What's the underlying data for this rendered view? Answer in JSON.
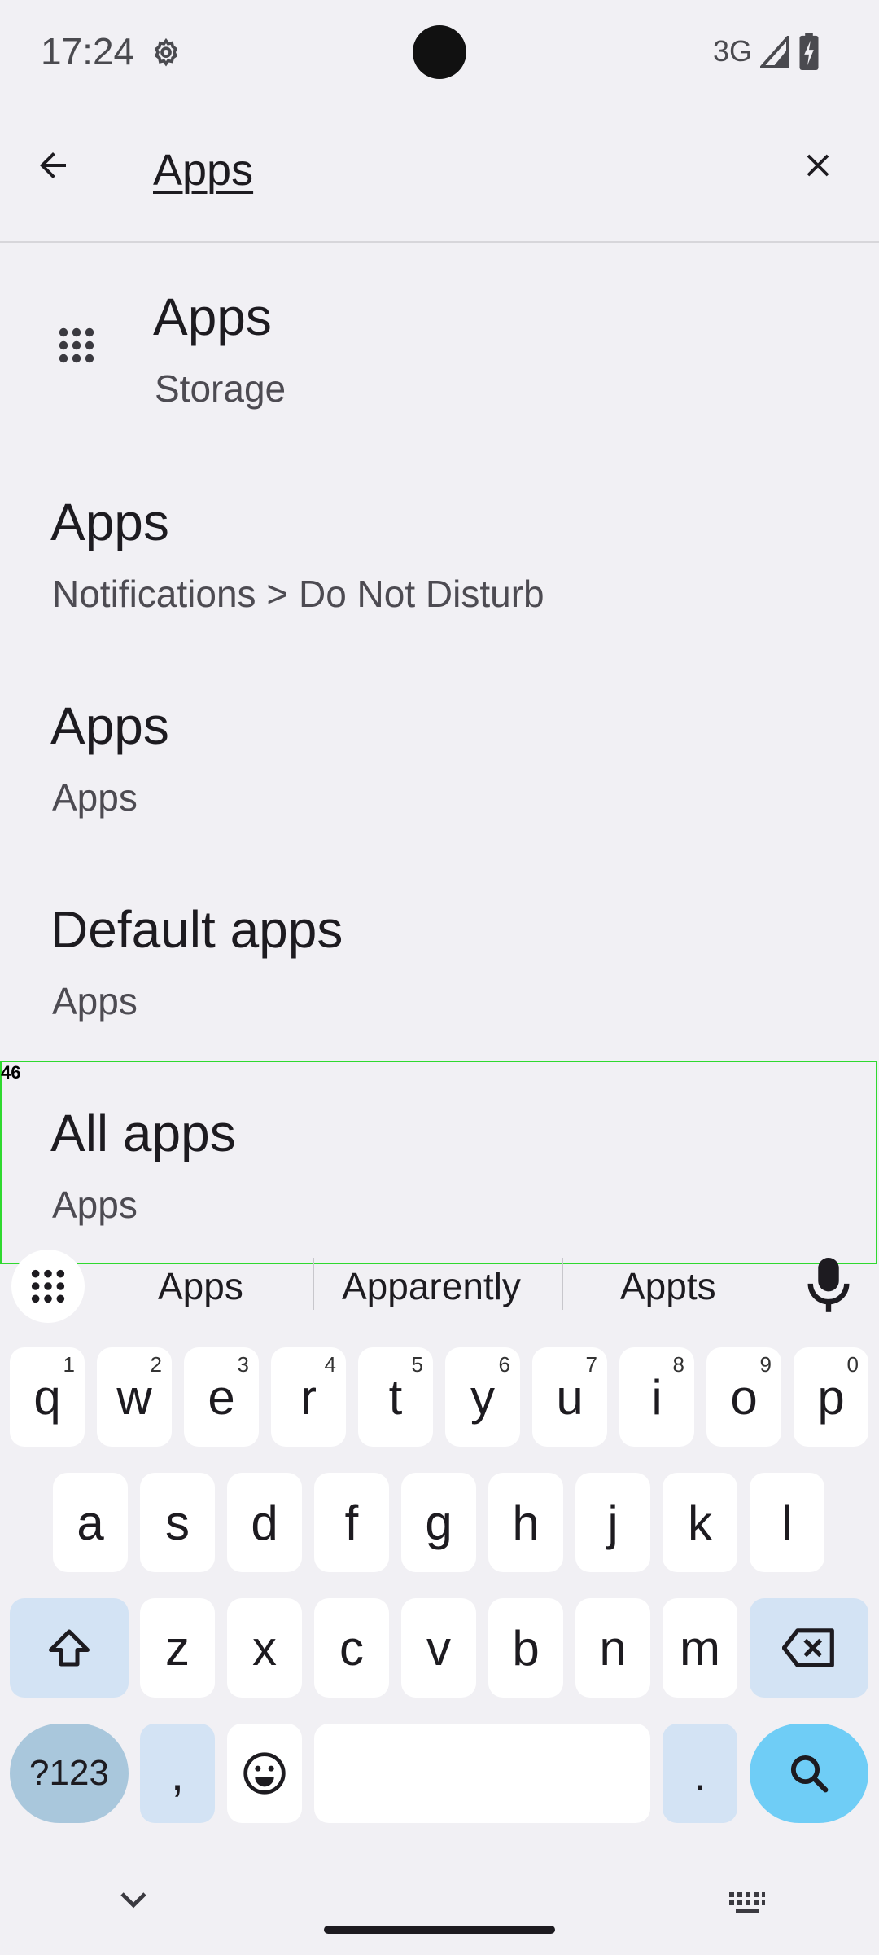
{
  "status": {
    "time": "17:24",
    "network": "3G"
  },
  "search": {
    "query": "Apps"
  },
  "results": [
    {
      "title": "Apps",
      "subtitle": "Storage"
    },
    {
      "title": "Apps",
      "subtitle": "Notifications > Do Not Disturb"
    },
    {
      "title": "Apps",
      "subtitle": "Apps"
    },
    {
      "title": "Default apps",
      "subtitle": "Apps"
    },
    {
      "title": "All apps",
      "subtitle": "Apps"
    }
  ],
  "overlay": {
    "label": "46",
    "color": "#2fd92f"
  },
  "suggestions": [
    "Apps",
    "Apparently",
    "Appts"
  ],
  "keyboard": {
    "row1": [
      {
        "k": "q",
        "n": "1"
      },
      {
        "k": "w",
        "n": "2"
      },
      {
        "k": "e",
        "n": "3"
      },
      {
        "k": "r",
        "n": "4"
      },
      {
        "k": "t",
        "n": "5"
      },
      {
        "k": "y",
        "n": "6"
      },
      {
        "k": "u",
        "n": "7"
      },
      {
        "k": "i",
        "n": "8"
      },
      {
        "k": "o",
        "n": "9"
      },
      {
        "k": "p",
        "n": "0"
      }
    ],
    "row2": [
      "a",
      "s",
      "d",
      "f",
      "g",
      "h",
      "j",
      "k",
      "l"
    ],
    "row3": [
      "z",
      "x",
      "c",
      "v",
      "b",
      "n",
      "m"
    ],
    "sym_label": "?123",
    "comma": ",",
    "period": "."
  },
  "colors": {
    "background": "#f1f0f4",
    "accent_search": "#6fcdf6",
    "function_key": "#d3e3f4"
  }
}
